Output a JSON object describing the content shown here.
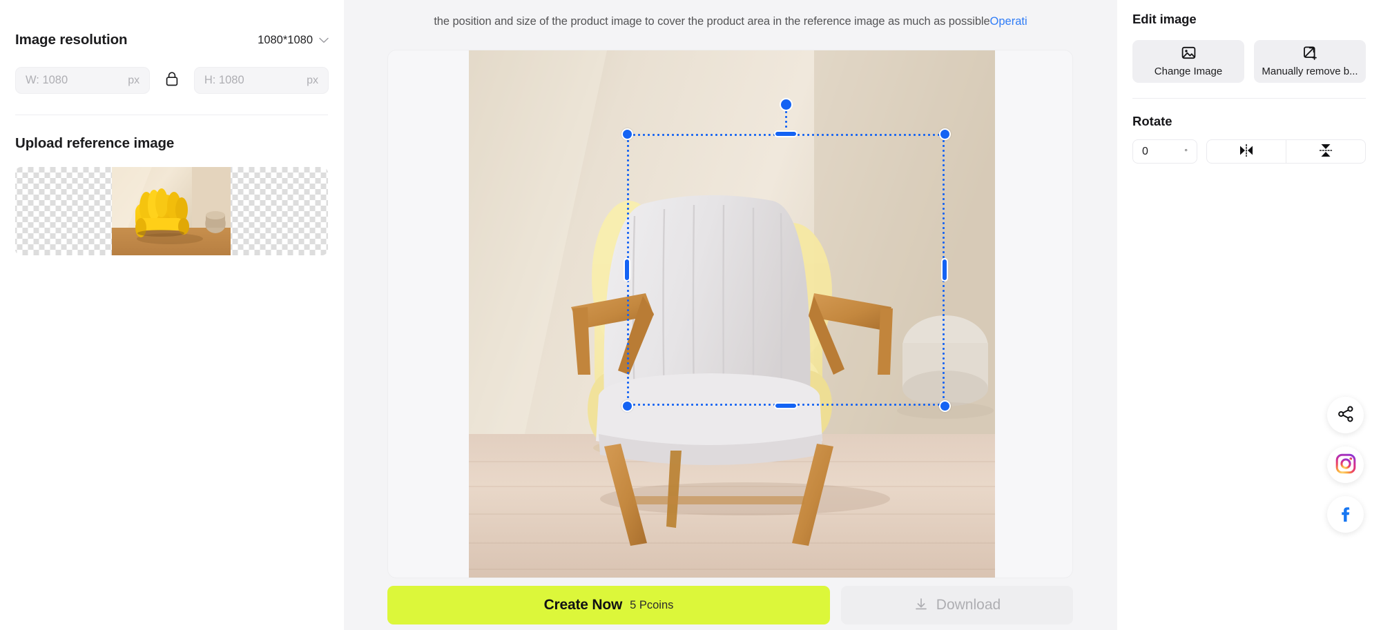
{
  "left": {
    "resolution_title": "Image resolution",
    "resolution_value": "1080*1080",
    "width_placeholder": "W: 1080",
    "width_value": "",
    "height_placeholder": "H: 1080",
    "height_value": "",
    "unit": "px",
    "lock_state": "locked",
    "upload_title": "Upload reference image"
  },
  "center": {
    "hint_text": "the position and size of the product image to cover the product area in the reference image as much as possible",
    "hint_link": "Operati",
    "create_label": "Create Now",
    "create_cost": "5 Pcoins",
    "download_label": "Download"
  },
  "right": {
    "edit_title": "Edit image",
    "change_image_label": "Change Image",
    "remove_bg_label": "Manually remove b...",
    "rotate_title": "Rotate",
    "rotate_value": "0",
    "degree_symbol": "°",
    "flip_horizontal": "flip-horizontal",
    "flip_vertical": "flip-vertical"
  },
  "social": {
    "share": "share-icon",
    "instagram": "instagram-icon",
    "facebook": "facebook-icon"
  },
  "colors": {
    "accent_blue": "#1463f3",
    "create_green": "#dcf73a",
    "link_blue": "#2f7cf6",
    "panel_gray": "#f4f4f6"
  }
}
